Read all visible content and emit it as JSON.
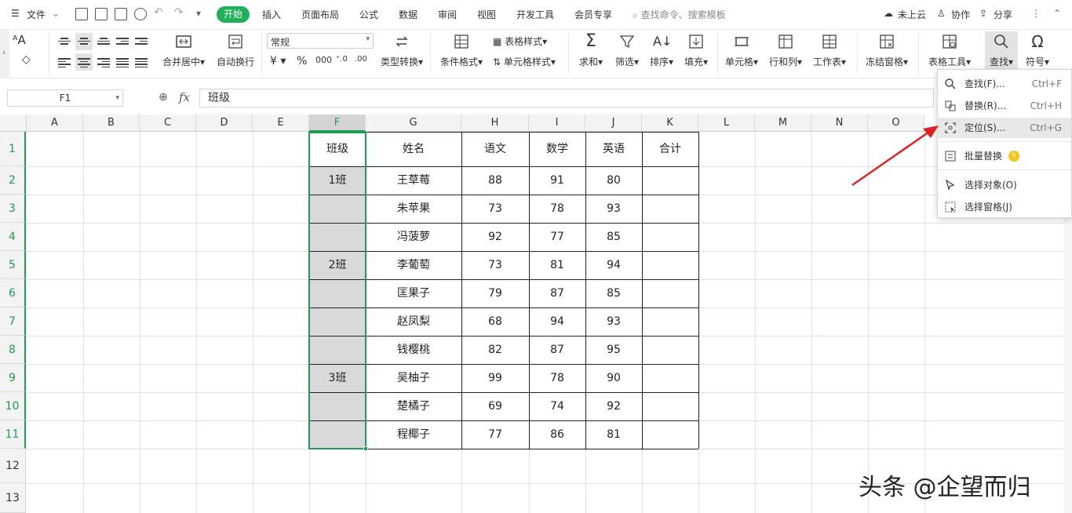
{
  "menubar": {
    "file_label": "文件",
    "tabs": [
      "开始",
      "插入",
      "页面布局",
      "公式",
      "数据",
      "审阅",
      "视图",
      "开发工具",
      "会员专享"
    ],
    "search_placeholder": "查找命令、搜索模板",
    "cloud": "未上云",
    "collab": "协作",
    "share": "分享"
  },
  "ribbon": {
    "merge_center": "合并居中",
    "wrap_text": "自动换行",
    "number_format": "常规",
    "type_convert": "类型转换",
    "cond_format": "条件格式",
    "table_style": "表格样式",
    "cell_style": "单元格样式",
    "sum": "求和",
    "filter": "筛选",
    "sort": "排序",
    "fill": "填充",
    "cell": "单元格",
    "row_col": "行和列",
    "worksheet": "工作表",
    "freeze": "冻结窗格",
    "table_tools": "表格工具",
    "find": "查找",
    "symbol": "符号"
  },
  "formula_bar": {
    "name_box": "F1",
    "fx": "fx",
    "value": "班级"
  },
  "columns": [
    "A",
    "B",
    "C",
    "D",
    "E",
    "F",
    "G",
    "H",
    "I",
    "J",
    "K",
    "L",
    "M",
    "N",
    "O"
  ],
  "rows": [
    "1",
    "2",
    "3",
    "4",
    "5",
    "6",
    "7",
    "8",
    "9",
    "10",
    "11",
    "12",
    "13"
  ],
  "table": {
    "headers": [
      "班级",
      "姓名",
      "语文",
      "数学",
      "英语",
      "合计"
    ],
    "rows": [
      [
        "1班",
        "王草莓",
        "88",
        "91",
        "80",
        ""
      ],
      [
        "",
        "朱苹果",
        "73",
        "78",
        "93",
        ""
      ],
      [
        "",
        "冯菠萝",
        "92",
        "77",
        "85",
        ""
      ],
      [
        "2班",
        "李葡萄",
        "73",
        "81",
        "94",
        ""
      ],
      [
        "",
        "匡果子",
        "79",
        "87",
        "85",
        ""
      ],
      [
        "",
        "赵凤梨",
        "68",
        "94",
        "93",
        ""
      ],
      [
        "",
        "钱樱桃",
        "82",
        "87",
        "95",
        ""
      ],
      [
        "3班",
        "吴柚子",
        "99",
        "78",
        "90",
        ""
      ],
      [
        "",
        "楚橘子",
        "69",
        "74",
        "92",
        ""
      ],
      [
        "",
        "程椰子",
        "77",
        "86",
        "81",
        ""
      ]
    ]
  },
  "dropdown": {
    "find": "查找(F)...",
    "find_sc": "Ctrl+F",
    "replace": "替换(R)...",
    "replace_sc": "Ctrl+H",
    "goto": "定位(S)...",
    "goto_sc": "Ctrl+G",
    "batch_replace": "批量替换",
    "select_objects": "选择对象(O)",
    "selection_pane": "选择窗格(J)"
  },
  "watermark": "头条 @企望而归",
  "colors": {
    "accent": "#1fb05a",
    "selection": "#1e9b55",
    "arrow": "#e02020"
  }
}
